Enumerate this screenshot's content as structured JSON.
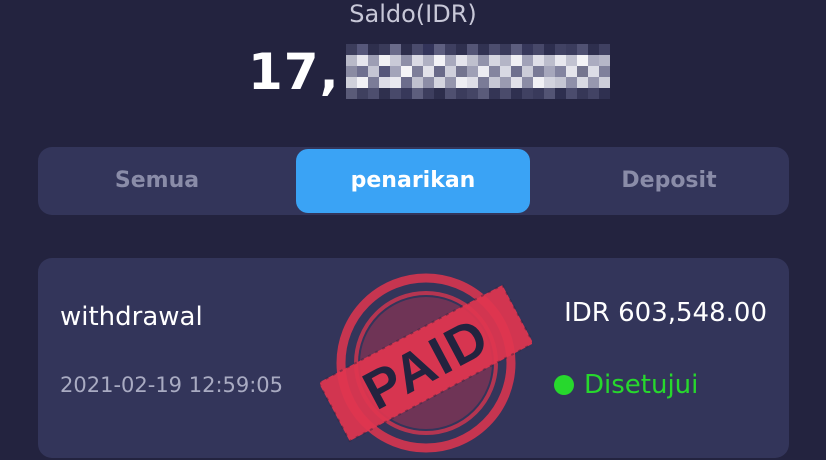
{
  "header": {
    "balance_label": "Saldo(IDR)",
    "balance_visible_prefix": "17,"
  },
  "tabs": [
    {
      "label": "Semua",
      "active": false
    },
    {
      "label": "penarikan",
      "active": true
    },
    {
      "label": "Deposit",
      "active": false
    }
  ],
  "transaction": {
    "type": "withdrawal",
    "datetime": "2021-02-19 12:59:05",
    "amount": "IDR 603,548.00",
    "status": "Disetujui",
    "stamp_text": "PAID"
  },
  "colors": {
    "background": "#23233f",
    "panel": "#33355a",
    "active_tab": "#3aa3f5",
    "status_ok": "#27d82d",
    "stamp": "#e0354f"
  }
}
